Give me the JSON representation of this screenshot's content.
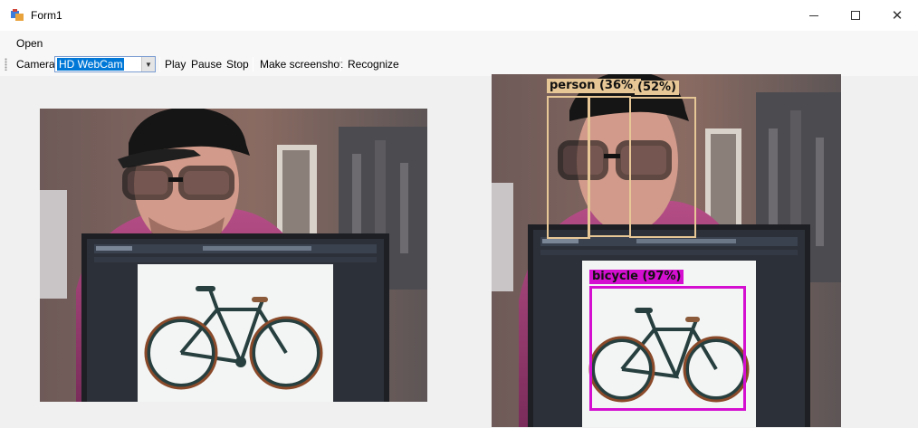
{
  "window": {
    "title": "Form1",
    "icon": "winforms-app-icon",
    "controls": [
      "minimize-icon",
      "maximize-icon",
      "close-icon"
    ]
  },
  "menu": {
    "items": [
      {
        "label": "Open"
      }
    ]
  },
  "toolbar": {
    "camera_label": "Camera",
    "camera_selected": "HD WebCam",
    "buttons": [
      {
        "label": "Play"
      },
      {
        "label": "Pause"
      },
      {
        "label": "Stop"
      },
      {
        "label": "Make screenshot"
      },
      {
        "label": "Recognize"
      }
    ]
  },
  "detections": [
    {
      "label": "person (36%)",
      "class": "person",
      "confidence": 0.36
    },
    {
      "label": "(52%)",
      "class": "person",
      "confidence": 0.52
    },
    {
      "label": "bicycle (97%)",
      "class": "bicycle",
      "confidence": 0.97
    }
  ],
  "colors": {
    "person_box": "#e7c796",
    "bicycle_box": "#d40fd0",
    "selection": "#0078d7"
  }
}
